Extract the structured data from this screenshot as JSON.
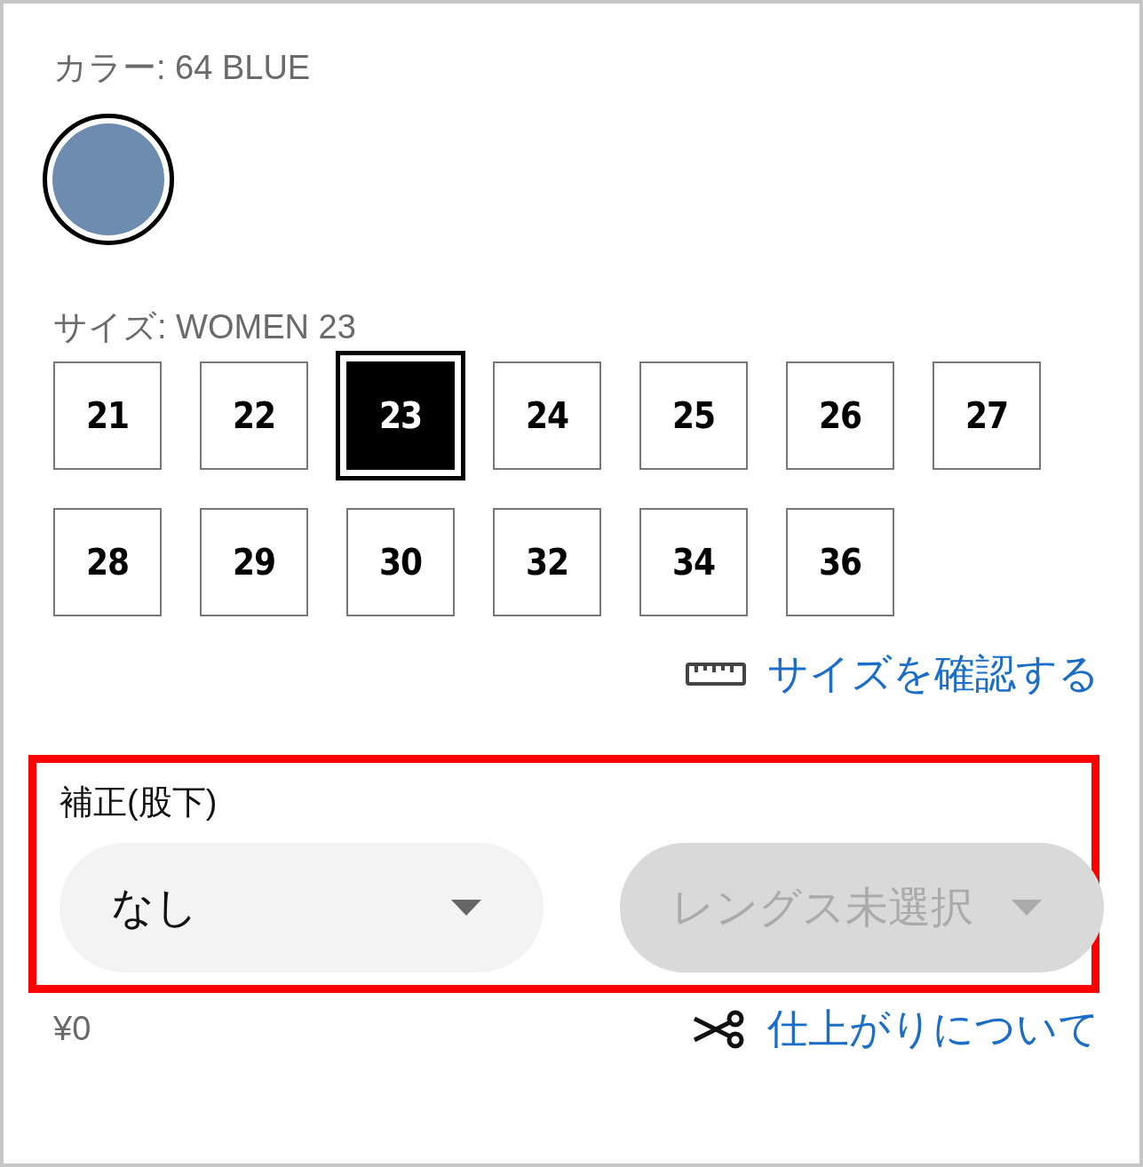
{
  "color_label": "カラー: 64 BLUE",
  "swatches": [
    {
      "selected": true,
      "color": "#6d8cb0"
    }
  ],
  "size_label": "サイズ: WOMEN 23",
  "sizes": [
    {
      "label": "21",
      "selected": false
    },
    {
      "label": "22",
      "selected": false
    },
    {
      "label": "23",
      "selected": true
    },
    {
      "label": "24",
      "selected": false
    },
    {
      "label": "25",
      "selected": false
    },
    {
      "label": "26",
      "selected": false
    },
    {
      "label": "27",
      "selected": false
    },
    {
      "label": "28",
      "selected": false
    },
    {
      "label": "29",
      "selected": false
    },
    {
      "label": "30",
      "selected": false
    },
    {
      "label": "32",
      "selected": false
    },
    {
      "label": "34",
      "selected": false
    },
    {
      "label": "36",
      "selected": false
    }
  ],
  "size_guide_link": "サイズを確認する",
  "alteration": {
    "title": "補正(股下)",
    "highlighted": true,
    "selects": [
      {
        "value": "なし",
        "disabled": false
      },
      {
        "value": "レングス未選択",
        "disabled": true
      }
    ]
  },
  "price": "¥0",
  "finishing_link": "仕上がりについて"
}
